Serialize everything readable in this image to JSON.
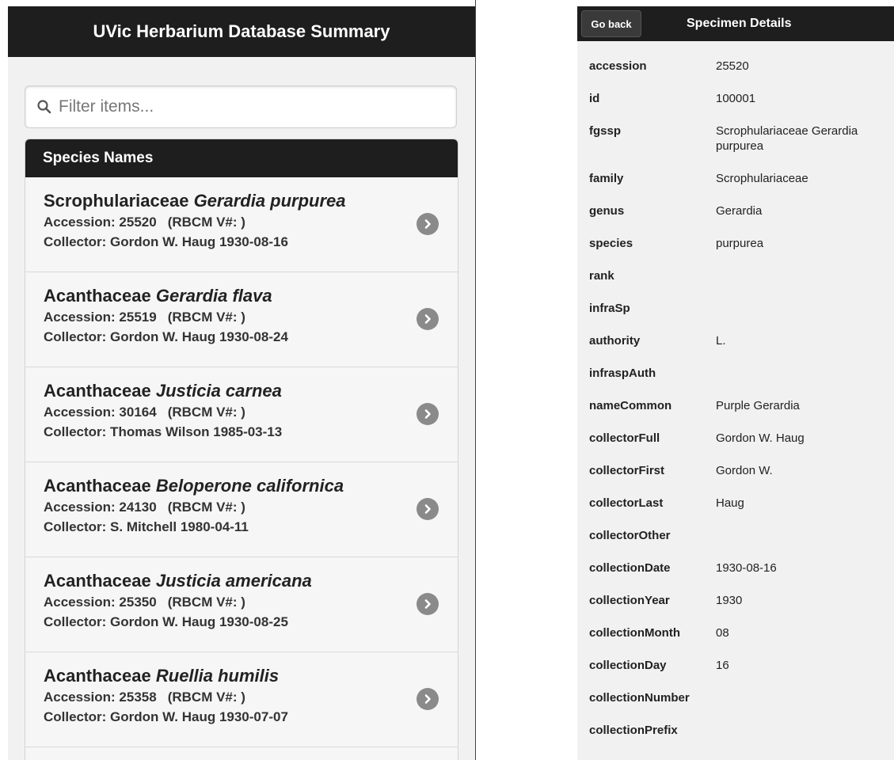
{
  "left": {
    "title": "UVic Herbarium Database Summary",
    "search_placeholder": "Filter items...",
    "list_header": "Species Names",
    "items": [
      {
        "family": "Scrophulariaceae",
        "species": "Gerardia purpurea",
        "accession": "Accession: 25520",
        "rbcm": "(RBCM V#: )",
        "collector": "Collector: Gordon W. Haug 1930-08-16"
      },
      {
        "family": "Acanthaceae",
        "species": "Gerardia flava",
        "accession": "Accession: 25519",
        "rbcm": "(RBCM V#: )",
        "collector": "Collector: Gordon W. Haug 1930-08-24"
      },
      {
        "family": "Acanthaceae",
        "species": "Justicia carnea",
        "accession": "Accession: 30164",
        "rbcm": "(RBCM V#: )",
        "collector": "Collector: Thomas Wilson 1985-03-13"
      },
      {
        "family": "Acanthaceae",
        "species": "Beloperone californica",
        "accession": "Accession: 24130",
        "rbcm": "(RBCM V#: )",
        "collector": "Collector: S. Mitchell 1980-04-11"
      },
      {
        "family": "Acanthaceae",
        "species": "Justicia americana",
        "accession": "Accession: 25350",
        "rbcm": "(RBCM V#: )",
        "collector": "Collector: Gordon W. Haug 1930-08-25"
      },
      {
        "family": "Acanthaceae",
        "species": "Ruellia humilis",
        "accession": "Accession: 25358",
        "rbcm": "(RBCM V#: )",
        "collector": "Collector: Gordon W. Haug 1930-07-07"
      }
    ]
  },
  "right": {
    "back_label": "Go back",
    "title": "Specimen Details",
    "fields": [
      {
        "key": "accession",
        "value": "25520"
      },
      {
        "key": "id",
        "value": "100001"
      },
      {
        "key": "fgssp",
        "value": "Scrophulariaceae Gerardia purpurea"
      },
      {
        "key": "family",
        "value": "Scrophulariaceae"
      },
      {
        "key": "genus",
        "value": "Gerardia"
      },
      {
        "key": "species",
        "value": "purpurea"
      },
      {
        "key": "rank",
        "value": ""
      },
      {
        "key": "infraSp",
        "value": ""
      },
      {
        "key": "authority",
        "value": "L."
      },
      {
        "key": "infraspAuth",
        "value": ""
      },
      {
        "key": "nameCommon",
        "value": "Purple Gerardia"
      },
      {
        "key": "collectorFull",
        "value": "Gordon W. Haug"
      },
      {
        "key": "collectorFirst",
        "value": "Gordon W."
      },
      {
        "key": "collectorLast",
        "value": "Haug"
      },
      {
        "key": "collectorOther",
        "value": ""
      },
      {
        "key": "collectionDate",
        "value": "1930-08-16"
      },
      {
        "key": "collectionYear",
        "value": "1930"
      },
      {
        "key": "collectionMonth",
        "value": "08"
      },
      {
        "key": "collectionDay",
        "value": "16"
      },
      {
        "key": "collectionNumber",
        "value": ""
      },
      {
        "key": "collectionPrefix",
        "value": ""
      }
    ]
  },
  "icons": {
    "search": "search-icon",
    "item_arrow": "chevron-right-icon"
  },
  "colors": {
    "header_bg": "#1e1e1e",
    "panel_bg": "#f1f1f1",
    "chevron": "#8a8a8a"
  }
}
